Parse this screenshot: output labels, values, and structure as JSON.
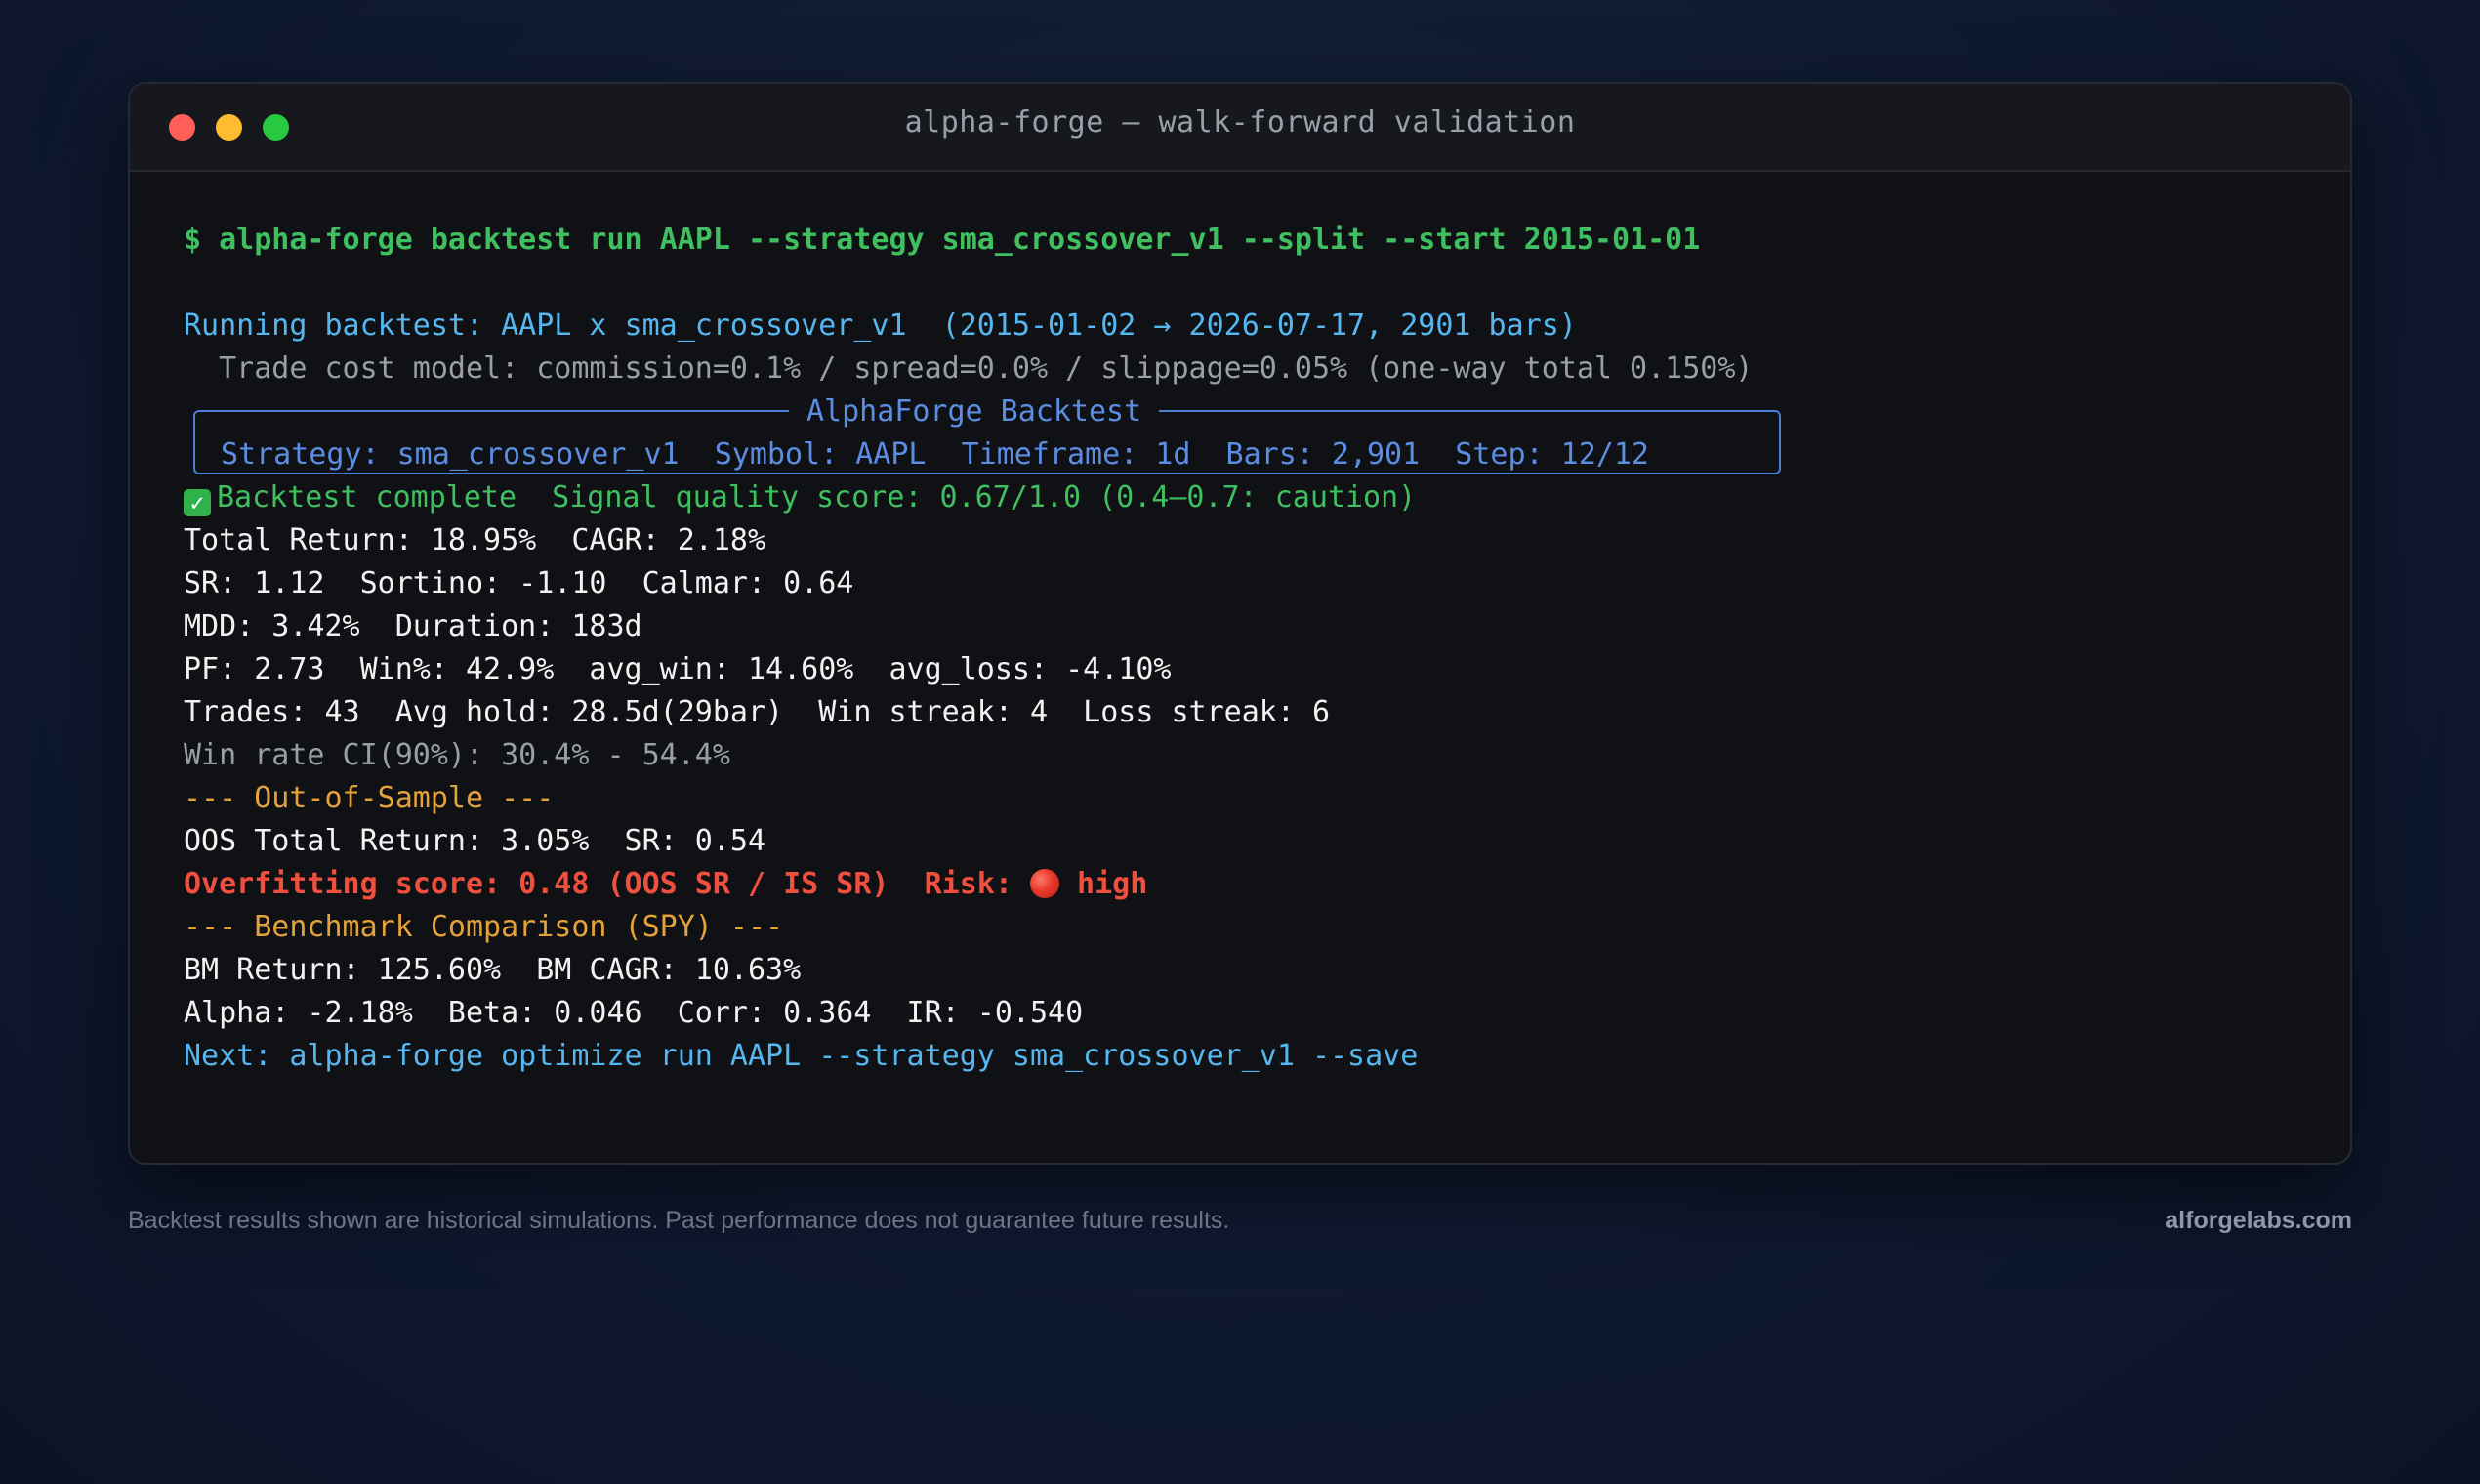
{
  "window": {
    "title": "alpha-forge — walk-forward validation"
  },
  "terminal": {
    "command": "$ alpha-forge backtest run AAPL --strategy sma_crossover_v1 --split --start 2015-01-01",
    "running": "Running backtest: AAPL x sma_crossover_v1  (2015-01-02 → 2026-07-17, 2901 bars)",
    "cost_model": "  Trade cost model: commission=0.1% / spread=0.0% / slippage=0.05% (one-way total 0.150%)",
    "panel": {
      "title": "AlphaForge Backtest",
      "content": "Strategy: sma_crossover_v1  Symbol: AAPL  Timeframe: 1d  Bars: 2,901  Step: 12/12"
    },
    "complete": "Backtest complete  Signal quality score: 0.67/1.0 (0.4–0.7: caution)",
    "metrics": [
      "Total Return: 18.95%  CAGR: 2.18%",
      "SR: 1.12  Sortino: -1.10  Calmar: 0.64",
      "MDD: 3.42%  Duration: 183d",
      "PF: 2.73  Win%: 42.9%  avg_win: 14.60%  avg_loss: -4.10%",
      "Trades: 43  Avg hold: 28.5d(29bar)  Win streak: 4  Loss streak: 6"
    ],
    "winrate_ci": "Win rate CI(90%): 30.4% - 54.4%",
    "oos_header": "--- Out-of-Sample ---",
    "oos_line": "OOS Total Return: 3.05%  SR: 0.54",
    "overfit_text": "Overfitting score: 0.48 (OOS SR / IS SR)  Risk: ",
    "overfit_level": " high",
    "benchmark_header": "--- Benchmark Comparison (SPY) ---",
    "benchmark_lines": [
      "BM Return: 125.60%  BM CAGR: 10.63%",
      "Alpha: -2.18%  Beta: 0.046  Corr: 0.364  IR: -0.540"
    ],
    "next": "Next: alpha-forge optimize run AAPL --strategy sma_crossover_v1 --save"
  },
  "footer": {
    "disclaimer": "Backtest results shown are historical simulations. Past performance does not guarantee future results.",
    "brand": "alforgelabs.com"
  },
  "icons": {
    "check": "check-mark-icon",
    "risk": "red-circle-icon"
  },
  "colors": {
    "command": "#3fbf5f",
    "info": "#56b7f0",
    "section": "#e4a33a",
    "risk": "#ee4f3e",
    "panel": "#5b8de3"
  }
}
